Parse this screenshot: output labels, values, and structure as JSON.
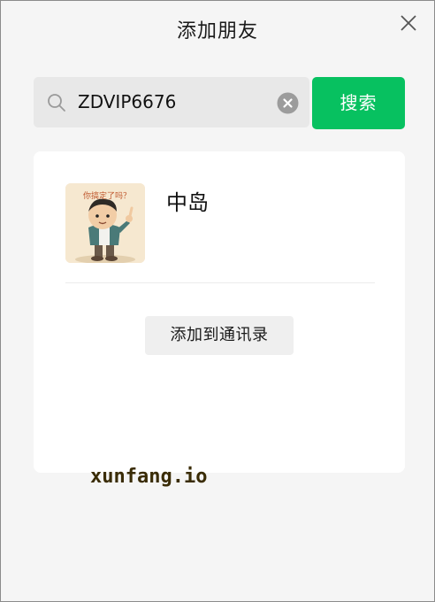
{
  "dialog": {
    "title": "添加朋友",
    "close_icon": "close-icon"
  },
  "search": {
    "value": "ZDVIP6676",
    "placeholder": "",
    "search_icon": "search-icon",
    "clear_icon": "clear-circle-icon",
    "button_label": "搜索",
    "button_color": "#07c160"
  },
  "result": {
    "username": "中岛",
    "avatar_icon": "cartoon-boy-avatar",
    "avatar_text": "你搞定了吗？",
    "add_label": "添加到通讯录"
  },
  "watermark": "xunfang.io"
}
